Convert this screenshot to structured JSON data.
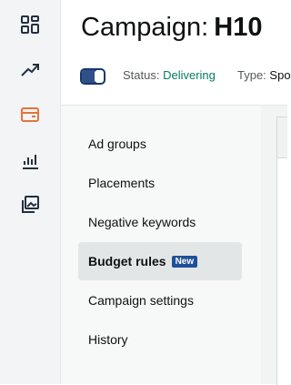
{
  "rail": {
    "icons": [
      "dashboard-icon",
      "trending-up-icon",
      "campaign-card-icon",
      "bar-chart-icon",
      "media-gallery-icon"
    ],
    "active_color": "#e3743a",
    "icon_color": "#232f3e"
  },
  "header": {
    "title_prefix": "Campaign:",
    "title_name": "H10",
    "status_label": "Status:",
    "status_value": "Delivering",
    "type_label": "Type:",
    "type_value": "Spo"
  },
  "nav": {
    "items": [
      {
        "label": "Ad groups"
      },
      {
        "label": "Placements"
      },
      {
        "label": "Negative keywords"
      },
      {
        "label": "Budget rules",
        "badge": "New"
      },
      {
        "label": "Campaign settings"
      },
      {
        "label": "History"
      }
    ]
  },
  "colors": {
    "status_green": "#067d62",
    "badge_blue": "#1e4f9a",
    "toggle_blue": "#2f4f86"
  }
}
